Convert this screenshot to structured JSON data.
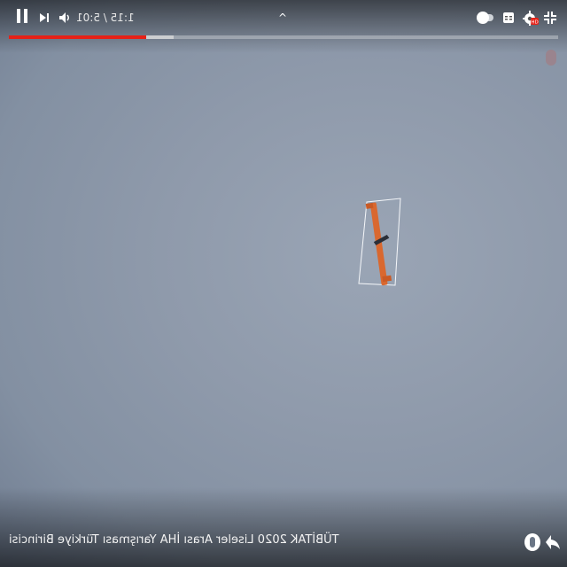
{
  "player": {
    "time_display": "1:15 / 5:01",
    "progress_played_fraction": 0.25,
    "progress_buffered_fraction": 0.3,
    "caret_symbol": "^",
    "quality_badge": "HD",
    "video_title": "TÜBİTAK 2020 Liseler Arası İHA Yarışması Türkiye Birincisi"
  },
  "icons": {
    "pause": "pause-icon",
    "next": "next-icon",
    "volume": "volume-icon",
    "autoplay": "autoplay-toggle-icon",
    "captions": "captions-icon",
    "settings": "settings-gear-icon",
    "exit_fullscreen": "exit-fullscreen-icon",
    "share": "share-icon",
    "watch_later": "arrow-icon"
  },
  "colors": {
    "progress_played": "#e62117",
    "sky": "#8f9aab",
    "plane_body": "#d9682f"
  }
}
